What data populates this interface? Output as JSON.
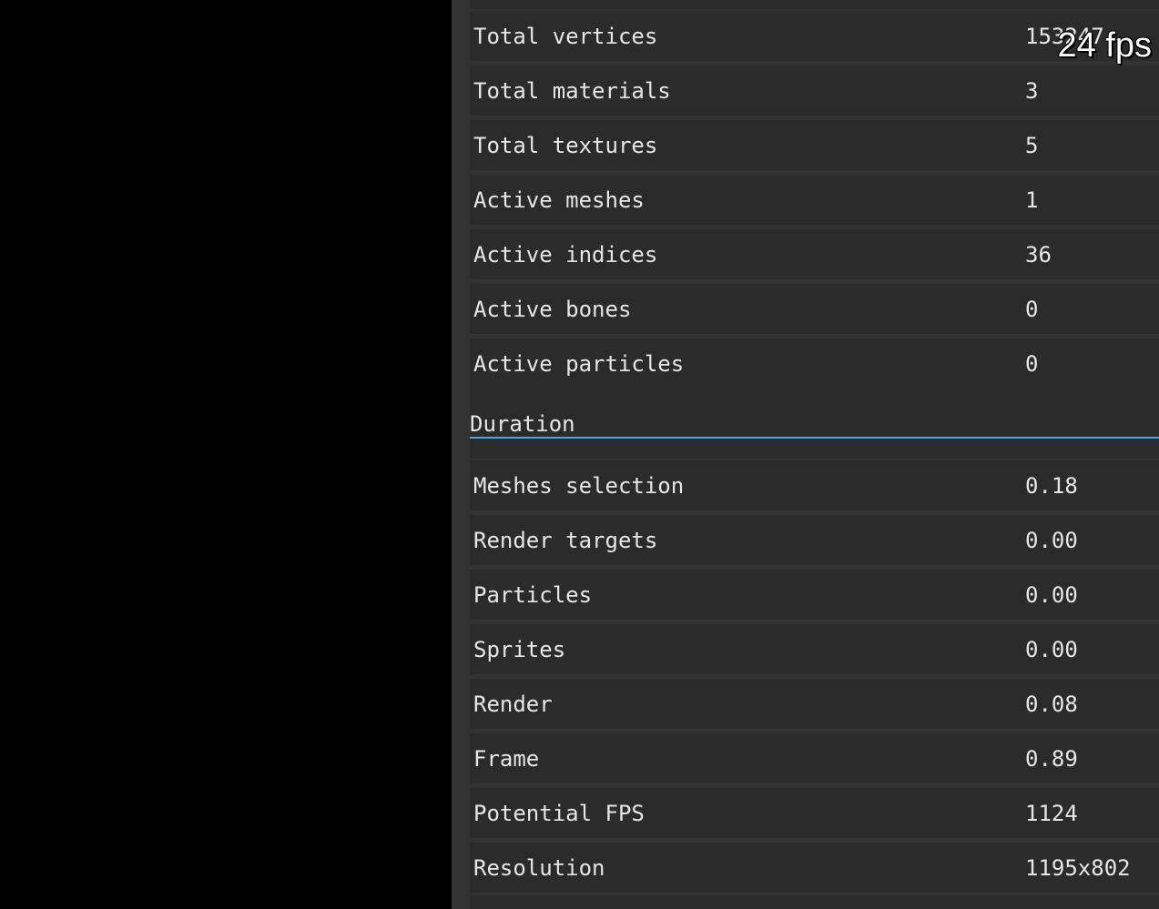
{
  "fps_counter": "24 fps",
  "count_rows": [
    {
      "label": "Total vertices",
      "value": "153247"
    },
    {
      "label": "Total materials",
      "value": "3"
    },
    {
      "label": "Total textures",
      "value": "5"
    },
    {
      "label": "Active meshes",
      "value": "1"
    },
    {
      "label": "Active indices",
      "value": "36"
    },
    {
      "label": "Active bones",
      "value": "0"
    },
    {
      "label": "Active particles",
      "value": "0"
    }
  ],
  "duration_section": {
    "title": "Duration",
    "rows": [
      {
        "label": "Meshes selection",
        "value": "0.18"
      },
      {
        "label": "Render targets",
        "value": "0.00"
      },
      {
        "label": "Particles",
        "value": "0.00"
      },
      {
        "label": "Sprites",
        "value": "0.00"
      },
      {
        "label": "Render",
        "value": "0.08"
      },
      {
        "label": "Frame",
        "value": "0.89"
      },
      {
        "label": "Potential FPS",
        "value": "1124"
      },
      {
        "label": "Resolution",
        "value": "1195x802"
      }
    ]
  },
  "colors": {
    "panel_background": "#333333",
    "row_background": "#2b2b2b",
    "section_underline": "#5aa3d6",
    "text": "#e6e6e6"
  }
}
